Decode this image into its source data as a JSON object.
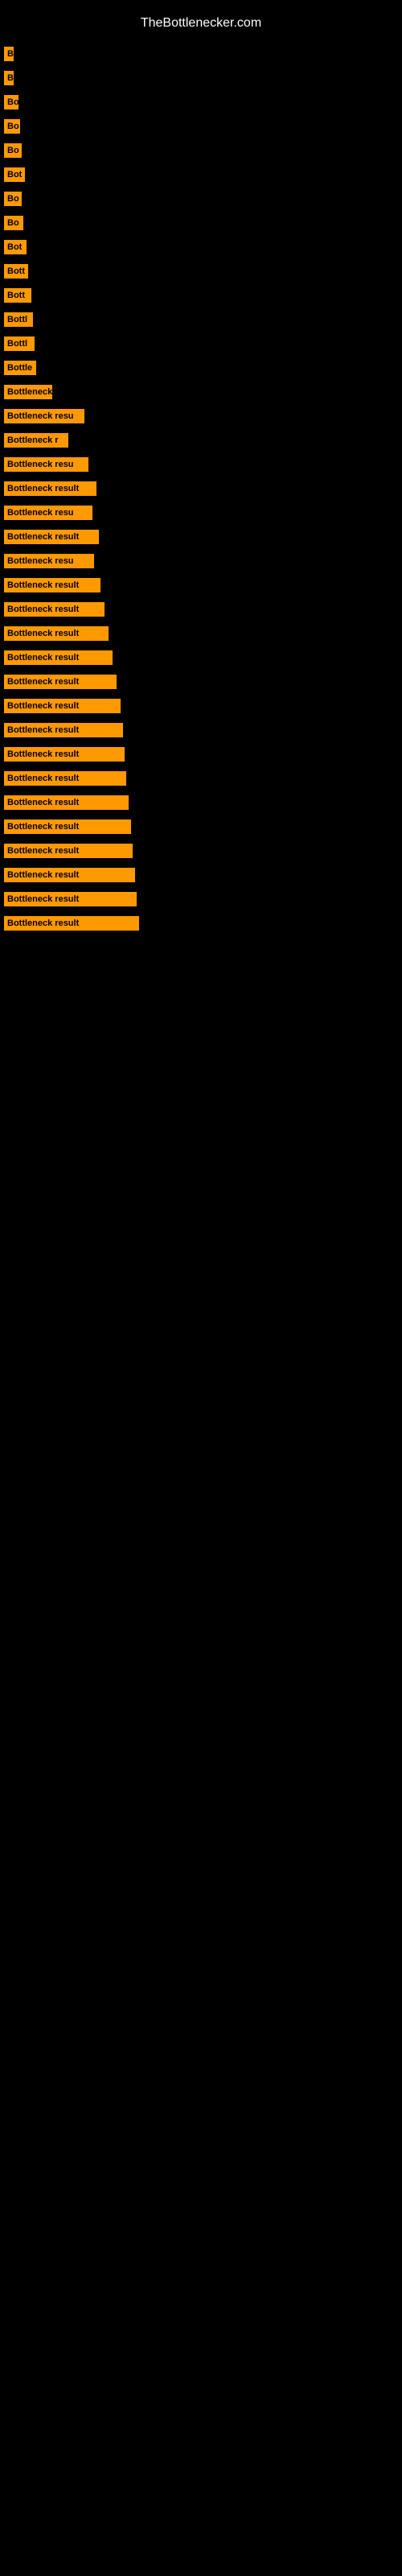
{
  "header": {
    "title": "TheBottlenecker.com"
  },
  "bars": [
    {
      "id": 1,
      "label": "B",
      "width": 12
    },
    {
      "id": 2,
      "label": "B",
      "width": 12
    },
    {
      "id": 3,
      "label": "Bo",
      "width": 18
    },
    {
      "id": 4,
      "label": "Bo",
      "width": 20
    },
    {
      "id": 5,
      "label": "Bo",
      "width": 22
    },
    {
      "id": 6,
      "label": "Bot",
      "width": 26
    },
    {
      "id": 7,
      "label": "Bo",
      "width": 22
    },
    {
      "id": 8,
      "label": "Bo",
      "width": 24
    },
    {
      "id": 9,
      "label": "Bot",
      "width": 28
    },
    {
      "id": 10,
      "label": "Bott",
      "width": 30
    },
    {
      "id": 11,
      "label": "Bott",
      "width": 34
    },
    {
      "id": 12,
      "label": "Bottl",
      "width": 36
    },
    {
      "id": 13,
      "label": "Bottl",
      "width": 38
    },
    {
      "id": 14,
      "label": "Bottle",
      "width": 40
    },
    {
      "id": 15,
      "label": "Bottleneck",
      "width": 60
    },
    {
      "id": 16,
      "label": "Bottleneck resu",
      "width": 100
    },
    {
      "id": 17,
      "label": "Bottleneck r",
      "width": 80
    },
    {
      "id": 18,
      "label": "Bottleneck resu",
      "width": 105
    },
    {
      "id": 19,
      "label": "Bottleneck result",
      "width": 115
    },
    {
      "id": 20,
      "label": "Bottleneck resu",
      "width": 110
    },
    {
      "id": 21,
      "label": "Bottleneck result",
      "width": 118
    },
    {
      "id": 22,
      "label": "Bottleneck resu",
      "width": 112
    },
    {
      "id": 23,
      "label": "Bottleneck result",
      "width": 120
    },
    {
      "id": 24,
      "label": "Bottleneck result",
      "width": 125
    },
    {
      "id": 25,
      "label": "Bottleneck result",
      "width": 130
    },
    {
      "id": 26,
      "label": "Bottleneck result",
      "width": 135
    },
    {
      "id": 27,
      "label": "Bottleneck result",
      "width": 140
    },
    {
      "id": 28,
      "label": "Bottleneck result",
      "width": 145
    },
    {
      "id": 29,
      "label": "Bottleneck result",
      "width": 148
    },
    {
      "id": 30,
      "label": "Bottleneck result",
      "width": 150
    },
    {
      "id": 31,
      "label": "Bottleneck result",
      "width": 152
    },
    {
      "id": 32,
      "label": "Bottleneck result",
      "width": 155
    },
    {
      "id": 33,
      "label": "Bottleneck result",
      "width": 158
    },
    {
      "id": 34,
      "label": "Bottleneck result",
      "width": 160
    },
    {
      "id": 35,
      "label": "Bottleneck result",
      "width": 163
    },
    {
      "id": 36,
      "label": "Bottleneck result",
      "width": 165
    },
    {
      "id": 37,
      "label": "Bottleneck result",
      "width": 168
    }
  ]
}
